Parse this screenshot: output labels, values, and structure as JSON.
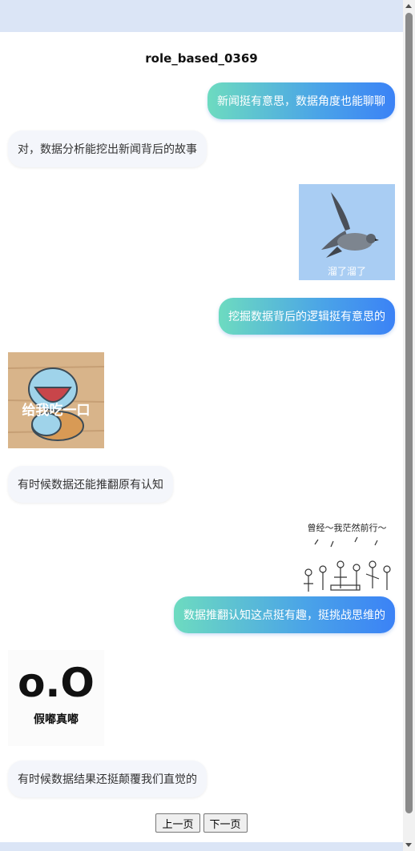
{
  "title": "role_based_0369",
  "messages": [
    {
      "side": "right",
      "type": "text",
      "text": "新闻挺有意思，数据角度也能聊聊"
    },
    {
      "side": "left",
      "type": "text",
      "text": "对，数据分析能挖出新闻背后的故事"
    },
    {
      "side": "right",
      "type": "image",
      "image": "pigeon-flying-sticker",
      "caption": "溜了溜了"
    },
    {
      "side": "right",
      "type": "text",
      "text": "挖掘数据背后的逻辑挺有意思的"
    },
    {
      "side": "left",
      "type": "image",
      "image": "squirtle-eating-sticker",
      "caption": "给我吃一口"
    },
    {
      "side": "left",
      "type": "text",
      "text": "有时候数据还能推翻原有认知"
    },
    {
      "side": "right",
      "type": "image",
      "image": "crowd-marching-sketch-sticker",
      "caption": "曾经～我茫然前行～"
    },
    {
      "side": "right",
      "type": "text",
      "text": "数据推翻认知这点挺有趣，挺挑战思维的"
    },
    {
      "side": "left",
      "type": "image",
      "image": "oo-face-text-sticker",
      "caption_big": "o.O",
      "caption": "假嘟真嘟"
    },
    {
      "side": "left",
      "type": "text",
      "text": "有时候数据结果还挺颠覆我们直觉的"
    }
  ],
  "pager": {
    "prev_label": "上一页",
    "next_label": "下一页"
  },
  "colors": {
    "bubble_gradient_start": "#6ddbc0",
    "bubble_gradient_end": "#3b82f6",
    "left_bubble": "#f4f6fb"
  }
}
